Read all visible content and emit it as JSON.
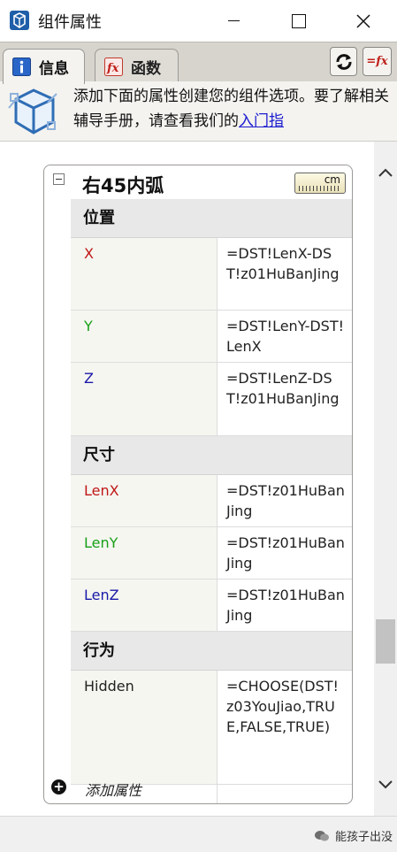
{
  "window": {
    "title": "组件属性",
    "icon": "sketchup-icon",
    "controls": [
      "minimize-icon",
      "maximize-icon",
      "close-icon"
    ]
  },
  "tabs": [
    {
      "label": "信息",
      "icon": "info-icon",
      "active": true
    },
    {
      "label": "函数",
      "icon": "fx-icon",
      "active": false
    }
  ],
  "toolbar": {
    "refresh_icon": "refresh-icon",
    "fx_label": "=fx"
  },
  "banner": {
    "icon": "component-cube-icon",
    "text": "添加下面的属性创建您的组件选项。要了解相关辅导手册，请查看我们的",
    "link": "入门指"
  },
  "component": {
    "name": "右45内弧",
    "units": "cm"
  },
  "sections": [
    {
      "title": "位置",
      "rows": [
        {
          "name": "X",
          "value": "=DST!LenX-DST!z01HuBanJing"
        },
        {
          "name": "Y",
          "value": "=DST!LenY-DST!LenX"
        },
        {
          "name": "Z",
          "value": "=DST!LenZ-DST!z01HuBanJing"
        }
      ]
    },
    {
      "title": "尺寸",
      "rows": [
        {
          "name": "LenX",
          "value": "=DST!z01HuBanJing"
        },
        {
          "name": "LenY",
          "value": "=DST!z01HuBanJing"
        },
        {
          "name": "LenZ",
          "value": "=DST!z01HuBanJing"
        }
      ]
    },
    {
      "title": "行为",
      "rows": [
        {
          "name": "Hidden",
          "value": "=CHOOSE(DST!z03YouJiao,TRUE,FALSE,TRUE)"
        }
      ]
    }
  ],
  "add_attribute": {
    "label": "添加属性",
    "icon": "plus-circle-icon"
  },
  "colors": {
    "x_axis": "#c01818",
    "y_axis": "#18a018",
    "z_axis": "#1a1aa8",
    "link": "#1a1ad0"
  },
  "watermark": {
    "text": "能孩子出没",
    "icon": "wechat-icon"
  }
}
